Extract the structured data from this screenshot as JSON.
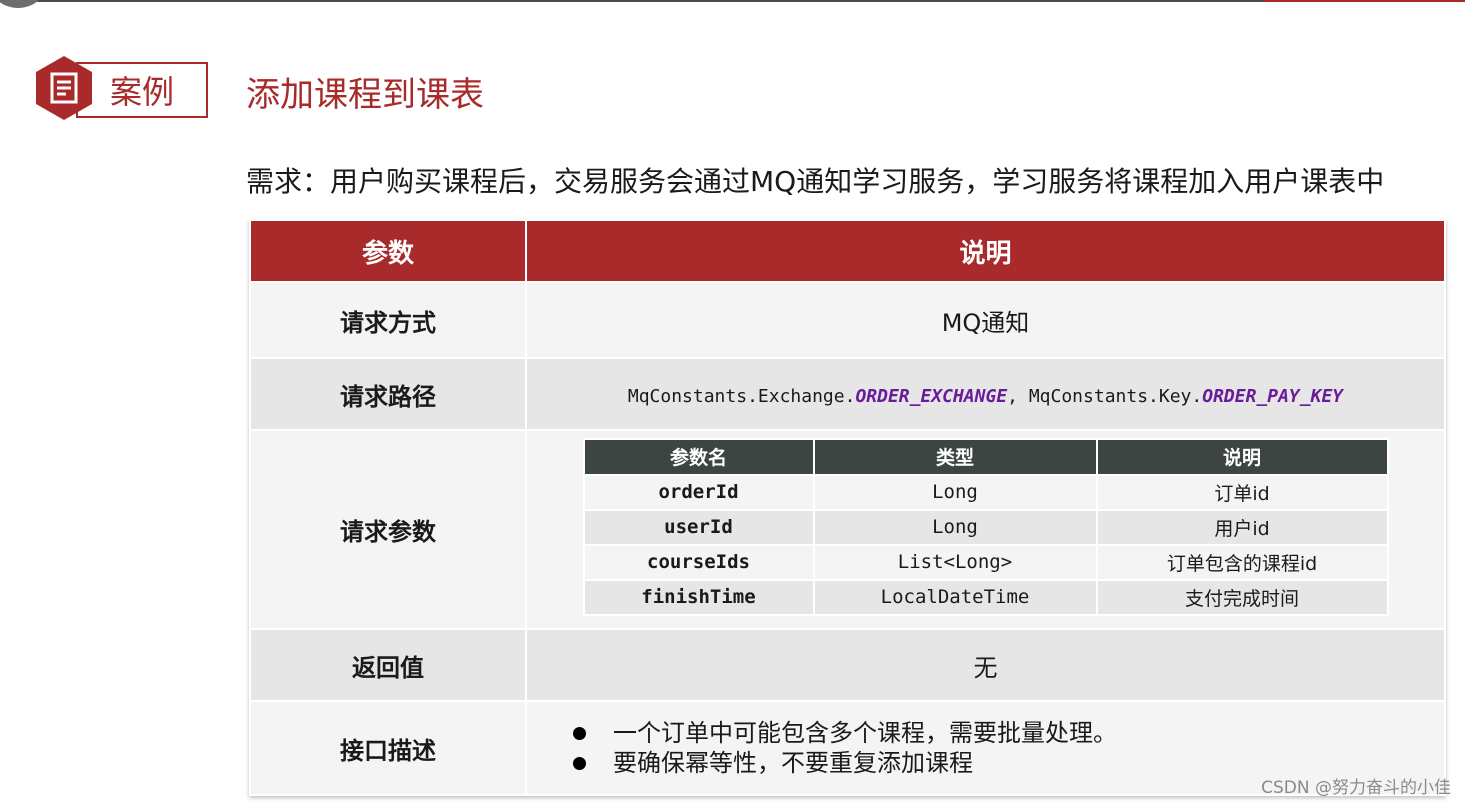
{
  "badge": {
    "label": "案例"
  },
  "page_title": "添加课程到课表",
  "requirement": "需求：用户购买课程后，交易服务会通过MQ通知学习服务，学习服务将课程加入用户课表中",
  "table": {
    "headers": [
      "参数",
      "说明"
    ],
    "request_method": {
      "param": "请求方式",
      "value": "MQ通知"
    },
    "request_path": {
      "param": "请求路径",
      "part1": "MqConstants.Exchange.",
      "const1": "ORDER_EXCHANGE",
      "sep": ", MqConstants.Key.",
      "const2": "ORDER_PAY_KEY"
    },
    "request_params": {
      "param": "请求参数",
      "headers": [
        "参数名",
        "类型",
        "说明"
      ],
      "rows": [
        {
          "name": "orderId",
          "type": "Long",
          "desc": "订单id"
        },
        {
          "name": "userId",
          "type": "Long",
          "desc": "用户id"
        },
        {
          "name": "courseIds",
          "type": "List<Long>",
          "desc": "订单包含的课程id"
        },
        {
          "name": "finishTime",
          "type": "LocalDateTime",
          "desc": "支付完成时间"
        }
      ]
    },
    "return_value": {
      "param": "返回值",
      "value": "无"
    },
    "interface_desc": {
      "param": "接口描述",
      "points": [
        "一个订单中可能包含多个课程，需要批量处理。",
        "要确保幂等性，不要重复添加课程"
      ]
    }
  },
  "watermark": "CSDN @努力奋斗的小佳",
  "colors": {
    "accent": "#a82a2a",
    "subheader": "#3d4543",
    "constant": "#6a1b9a"
  }
}
